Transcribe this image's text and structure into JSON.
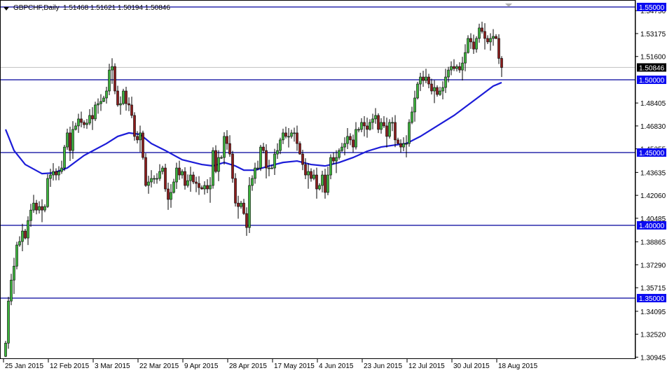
{
  "header": {
    "symbol": "GBPCHF,Daily",
    "ohlc": "1.51468 1.51621 1.50194 1.50846"
  },
  "colors": {
    "bull": "#3cb43c",
    "bear": "#8c1c1c",
    "ma": "#1c1cd8",
    "level": "#00009c",
    "level_label": "#0c0cf0",
    "price_line": "#c0c0c0"
  },
  "chart_data": {
    "type": "candlestick",
    "title": "GBPCHF,Daily",
    "ylim": [
      1.303,
      1.55
    ],
    "y_ticks": [
      "1.54750",
      "1.53175",
      "1.51600",
      "1.48405",
      "1.46830",
      "1.45255",
      "1.43635",
      "1.42060",
      "1.40485",
      "1.38865",
      "1.37290",
      "1.35715",
      "1.34095",
      "1.32520",
      "1.30945"
    ],
    "x_tick_labels": [
      {
        "bar": 0,
        "label": "25 Jan 2015"
      },
      {
        "bar": 16,
        "label": "12 Feb 2015"
      },
      {
        "bar": 32,
        "label": "3 Mar 2015"
      },
      {
        "bar": 48,
        "label": "22 Mar 2015"
      },
      {
        "bar": 64,
        "label": "9 Apr 2015"
      },
      {
        "bar": 80,
        "label": "28 Apr 2015"
      },
      {
        "bar": 96,
        "label": "17 May 2015"
      },
      {
        "bar": 112,
        "label": "4 Jun 2015"
      },
      {
        "bar": 128,
        "label": "23 Jun 2015"
      },
      {
        "bar": 144,
        "label": "12 Jul 2015"
      },
      {
        "bar": 160,
        "label": "30 Jul 2015"
      },
      {
        "bar": 176,
        "label": "18 Aug 2015"
      }
    ],
    "first_open": 1.31,
    "closes": [
      1.3191,
      1.348,
      1.3624,
      1.372,
      1.3865,
      1.3889,
      1.3961,
      1.3913,
      1.4033,
      1.4105,
      1.4153,
      1.4105,
      1.4129,
      1.4105,
      1.4129,
      1.4322,
      1.4346,
      1.437,
      1.4346,
      1.437,
      1.4394,
      1.4538,
      1.4635,
      1.4514,
      1.4659,
      1.4683,
      1.4731,
      1.4707,
      1.4692,
      1.4702,
      1.4755,
      1.4731,
      1.4827,
      1.4836,
      1.4851,
      1.4875,
      1.4923,
      1.5067,
      1.5091,
      1.4923,
      1.4827,
      1.4836,
      1.4923,
      1.4836,
      1.4827,
      1.4755,
      1.4611,
      1.4587,
      1.4635,
      1.4466,
      1.4274,
      1.4298,
      1.4322,
      1.4322,
      1.4322,
      1.437,
      1.4394,
      1.425,
      1.4178,
      1.4226,
      1.4298,
      1.4394,
      1.4346,
      1.437,
      1.4274,
      1.4307,
      1.4346,
      1.4298,
      1.4288,
      1.4259,
      1.425,
      1.4274,
      1.425,
      1.4274,
      1.4514,
      1.437,
      1.4466,
      1.4466,
      1.4611,
      1.4562,
      1.449,
      1.4322,
      1.4153,
      1.4129,
      1.4153,
      1.4081,
      1.3985,
      1.4274,
      1.4322,
      1.4394,
      1.4394,
      1.4538,
      1.4514,
      1.4394,
      1.4394,
      1.4394,
      1.449,
      1.4514,
      1.4587,
      1.4635,
      1.4611,
      1.4611,
      1.4635,
      1.4635,
      1.4562,
      1.449,
      1.4418,
      1.4346,
      1.437,
      1.4322,
      1.4346,
      1.425,
      1.4274,
      1.4346,
      1.4226,
      1.4346,
      1.4466,
      1.4442,
      1.4466,
      1.4514,
      1.4538,
      1.4562,
      1.4611,
      1.4587,
      1.4538,
      1.4659,
      1.4659,
      1.4707,
      1.4683,
      1.4659,
      1.4707,
      1.4731,
      1.4755,
      1.4659,
      1.4707,
      1.4683,
      1.4611,
      1.4707,
      1.4707,
      1.4587,
      1.4562,
      1.4538,
      1.4562,
      1.4562,
      1.4707,
      1.4779,
      1.4875,
      1.4971,
      1.5019,
      1.4995,
      1.5019,
      1.4971,
      1.4923,
      1.4947,
      1.4899,
      1.4923,
      1.4947,
      1.5019,
      1.5067,
      1.5091,
      1.5077,
      1.5091,
      1.5067,
      1.5115,
      1.5187,
      1.5284,
      1.526,
      1.5211,
      1.5284,
      1.5356,
      1.5332,
      1.5284,
      1.526,
      1.5284,
      1.5298,
      1.5284,
      1.51468,
      1.50846
    ],
    "last_bar": {
      "open": 1.51468,
      "high": 1.51621,
      "low": 1.50194,
      "close": 1.50846
    },
    "moving_average": [
      [
        0,
        1.4659
      ],
      [
        3,
        1.4514
      ],
      [
        7,
        1.4418
      ],
      [
        13,
        1.4355
      ],
      [
        17,
        1.436
      ],
      [
        22,
        1.4394
      ],
      [
        28,
        1.448
      ],
      [
        36,
        1.4562
      ],
      [
        40,
        1.4611
      ],
      [
        44,
        1.4635
      ],
      [
        48,
        1.4625
      ],
      [
        52,
        1.4562
      ],
      [
        57,
        1.4514
      ],
      [
        63,
        1.4451
      ],
      [
        70,
        1.4418
      ],
      [
        74,
        1.4408
      ],
      [
        78,
        1.4432
      ],
      [
        82,
        1.4408
      ],
      [
        85,
        1.4379
      ],
      [
        89,
        1.4379
      ],
      [
        94,
        1.4408
      ],
      [
        99,
        1.4432
      ],
      [
        104,
        1.4442
      ],
      [
        109,
        1.4418
      ],
      [
        114,
        1.4408
      ],
      [
        119,
        1.4432
      ],
      [
        124,
        1.4466
      ],
      [
        129,
        1.4509
      ],
      [
        134,
        1.4538
      ],
      [
        139,
        1.4552
      ],
      [
        143,
        1.4562
      ],
      [
        148,
        1.4611
      ],
      [
        154,
        1.4683
      ],
      [
        160,
        1.4755
      ],
      [
        165,
        1.4827
      ],
      [
        170,
        1.4899
      ],
      [
        174,
        1.4957
      ],
      [
        177,
        1.4981
      ]
    ],
    "levels": [
      {
        "value": 1.55,
        "label": "1.55000"
      },
      {
        "value": 1.5,
        "label": "1.50000"
      },
      {
        "value": 1.45,
        "label": "1.45000"
      },
      {
        "value": 1.4,
        "label": "1.40000"
      },
      {
        "value": 1.35,
        "label": "1.35000"
      }
    ],
    "current_price": {
      "value": 1.50846,
      "label": "1.50846"
    }
  }
}
